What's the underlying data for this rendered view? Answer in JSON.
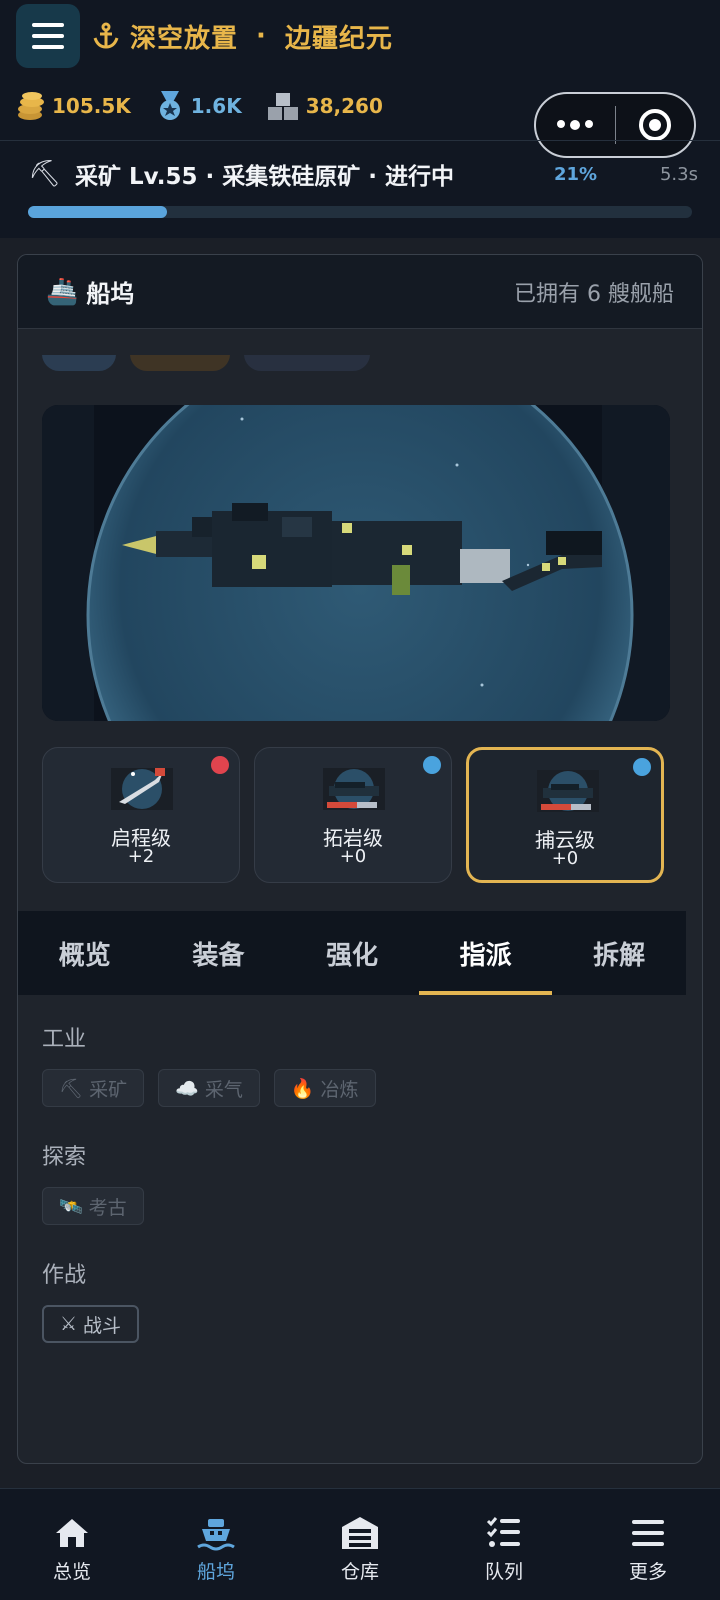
{
  "header": {
    "title": "深空放置",
    "separator": "·",
    "subtitle": "边疆纪元",
    "resources": {
      "coins": "105.5K",
      "medals": "1.6K",
      "cargo": "38,260"
    }
  },
  "task": {
    "text": "采矿 Lv.55 · 采集铁硅原矿 · 进行中",
    "percent": "21%",
    "progress": 0.21,
    "time": "5.3s"
  },
  "dock": {
    "title": "船坞",
    "owned": "已拥有 6 艘舰船",
    "ships": [
      {
        "name": "启程级",
        "level": "+2",
        "badge_color": "#e0444e"
      },
      {
        "name": "拓岩级",
        "level": "+0",
        "badge_color": "#4aa3de"
      },
      {
        "name": "捕云级",
        "level": "+0",
        "badge_color": "#4aa3de"
      }
    ]
  },
  "tabs": [
    "概览",
    "装备",
    "强化",
    "指派",
    "拆解"
  ],
  "active_tab": "指派",
  "dispatch": {
    "groups": [
      {
        "title": "工业",
        "items": [
          {
            "icon": "⛏",
            "label": "采矿"
          },
          {
            "icon": "☁️",
            "label": "采气"
          },
          {
            "icon": "🔥",
            "label": "冶炼"
          }
        ]
      },
      {
        "title": "探索",
        "items": [
          {
            "icon": "🛰️",
            "label": "考古"
          }
        ]
      },
      {
        "title": "作战",
        "items": [
          {
            "icon": "⚔",
            "label": "战斗"
          }
        ]
      }
    ]
  },
  "bottom_nav": [
    {
      "label": "总览",
      "icon": "home-icon"
    },
    {
      "label": "船坞",
      "icon": "ship-icon",
      "active": true
    },
    {
      "label": "仓库",
      "icon": "warehouse-icon"
    },
    {
      "label": "队列",
      "icon": "list-icon"
    },
    {
      "label": "更多",
      "icon": "menu-icon"
    }
  ],
  "colors": {
    "accent_gold": "#e3b552",
    "accent_blue": "#5fa6dd",
    "background": "#1b1f27"
  }
}
